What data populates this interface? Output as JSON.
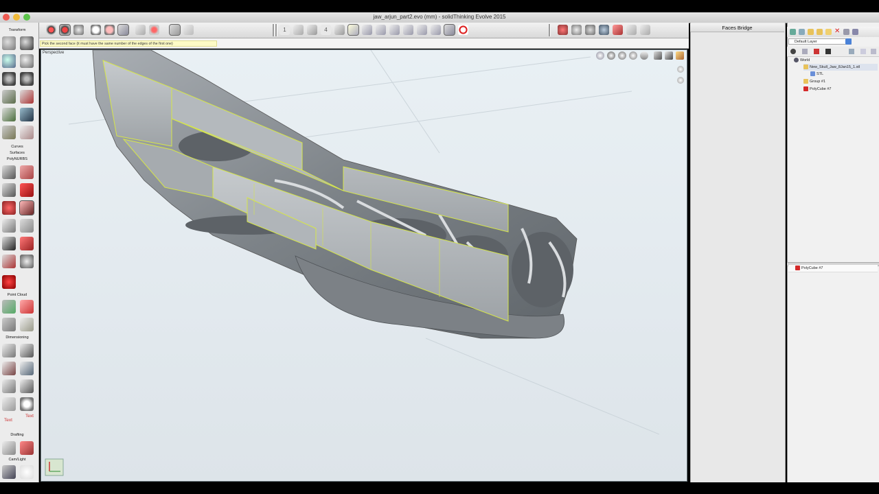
{
  "window": {
    "title": "jaw_arjun_part2.evo (mm) - solidThinking Evolve 2015"
  },
  "prompt": {
    "text": "Pick the second face (it must have the same number of the edges of the first one)"
  },
  "palette": {
    "sections": [
      "Transform",
      "Curves",
      "Surfaces",
      "PolyNURBS",
      "Point Cloud",
      "Dimensioning",
      "Drafting",
      "Cam/Light"
    ],
    "text_icon_labels": [
      "Text",
      "Text"
    ]
  },
  "viewport": {
    "label": "Perspective"
  },
  "toolbar": {
    "numbers": [
      "1",
      "4"
    ]
  },
  "faces_panel": {
    "title": "Faces Bridge"
  },
  "browser": {
    "layer": "Default Layer",
    "tree": [
      {
        "label": "World",
        "icon": "world-icon"
      },
      {
        "label": "New_Skull_Jaw_8Jan15_1.stl",
        "icon": "folder-icon"
      },
      {
        "label": "STL",
        "icon": "mesh-icon"
      },
      {
        "label": "Group #1",
        "icon": "folder-icon"
      },
      {
        "label": "PolyCube #7",
        "icon": "polycube-icon"
      }
    ],
    "property_object": "PolyCube #7"
  },
  "colors": {
    "accent_red": "#d42a2a",
    "selection_yellow": "#d6e64a",
    "viewport_bg": "#e4ebef",
    "model_gray": "#8e949a"
  }
}
